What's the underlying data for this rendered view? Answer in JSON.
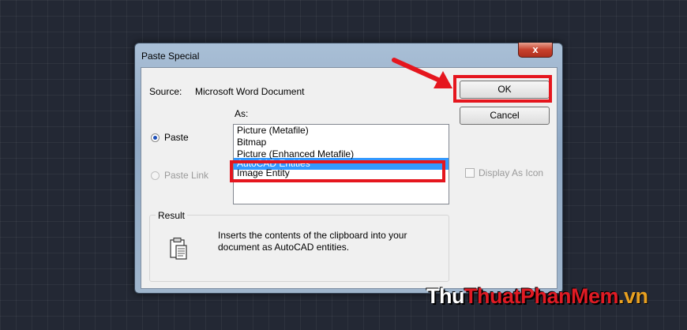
{
  "dialog": {
    "title": "Paste Special",
    "close_label": "x",
    "source_label": "Source:",
    "source_value": "Microsoft Word Document",
    "as_label": "As:",
    "paste_option": "Paste",
    "paste_link_option": "Paste Link",
    "list_items": [
      "Picture (Metafile)",
      "Bitmap",
      "Picture (Enhanced Metafile)",
      "AutoCAD Entities",
      "Image Entity"
    ],
    "selected_item": "AutoCAD Entities",
    "ok_label": "OK",
    "cancel_label": "Cancel",
    "display_as_icon_label": "Display As Icon",
    "result_label": "Result",
    "result_text": "Inserts the contents of the clipboard into your document as AutoCAD entities."
  },
  "watermark": {
    "part1": "Thu",
    "part2": "Thuat",
    "part3": "PhanMem",
    "part4": ".vn"
  },
  "colors": {
    "highlight": "#e5161e",
    "selection": "#3399ff",
    "background": "#232834"
  }
}
